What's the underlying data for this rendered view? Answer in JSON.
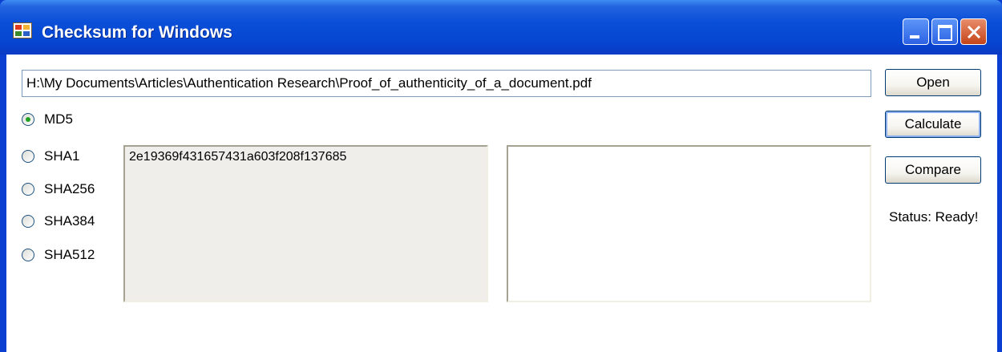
{
  "window": {
    "title": "Checksum for Windows",
    "icon": "app-icon",
    "controls": [
      "minimize-icon",
      "maximize-icon",
      "close-icon"
    ]
  },
  "file_path": {
    "value": "H:\\My Documents\\Articles\\Authentication Research\\Proof_of_authenticity_of_a_document.pdf"
  },
  "buttons": {
    "open": "Open",
    "calculate": "Calculate",
    "compare": "Compare"
  },
  "algorithms": {
    "selected": "MD5",
    "options": [
      "MD5",
      "SHA1",
      "SHA256",
      "SHA384",
      "SHA512"
    ]
  },
  "hashes": {
    "calculated": "2e19369f431657431a603f208f137685",
    "compare": ""
  },
  "status": "Status: Ready!",
  "colors": {
    "titlebar": "#0a4fd8",
    "close_button": "#c44419",
    "radio_dot": "#21a121"
  }
}
